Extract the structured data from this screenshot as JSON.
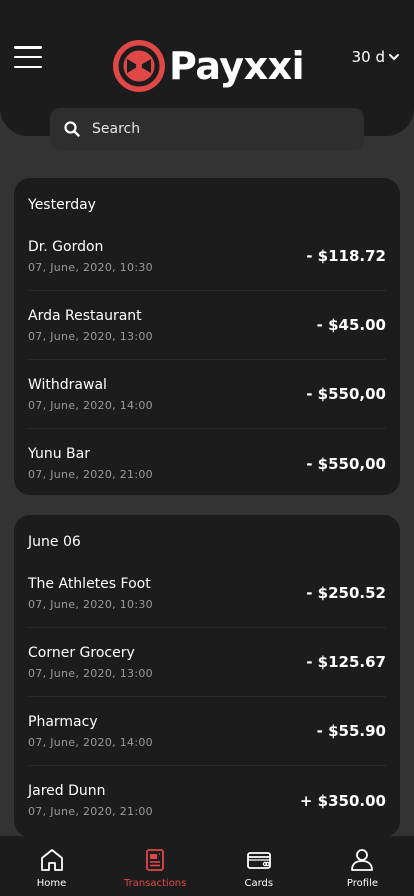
{
  "header": {
    "brand": "Payxxi",
    "period": "30 d",
    "search_placeholder": "Search"
  },
  "colors": {
    "accent": "#e04848",
    "background": "#333333",
    "card": "#1c1c1c"
  },
  "groups": [
    {
      "title": "Yesterday",
      "transactions": [
        {
          "name": "Dr. Gordon",
          "date": "07, June, 2020, 10:30",
          "amount": "- $118.72"
        },
        {
          "name": "Arda Restaurant",
          "date": "07, June, 2020, 13:00",
          "amount": "- $45.00"
        },
        {
          "name": "Withdrawal",
          "date": "07, June, 2020, 14:00",
          "amount": "- $550,00"
        },
        {
          "name": "Yunu Bar",
          "date": "07, June, 2020, 21:00",
          "amount": "- $550,00"
        }
      ]
    },
    {
      "title": "June 06",
      "transactions": [
        {
          "name": "The Athletes Foot",
          "date": "07, June, 2020, 10:30",
          "amount": "- $250.52"
        },
        {
          "name": "Corner Grocery",
          "date": "07, June, 2020, 13:00",
          "amount": "- $125.67"
        },
        {
          "name": "Pharmacy",
          "date": "07, June, 2020, 14:00",
          "amount": "- $55.90"
        },
        {
          "name": "Jared Dunn",
          "date": "07, June, 2020, 21:00",
          "amount": "+ $350.00"
        }
      ]
    }
  ],
  "nav": [
    {
      "label": "Home",
      "icon": "home-icon"
    },
    {
      "label": "Transactions",
      "icon": "transactions-icon",
      "active": true
    },
    {
      "label": "Cards",
      "icon": "cards-icon"
    },
    {
      "label": "Profile",
      "icon": "profile-icon"
    }
  ]
}
